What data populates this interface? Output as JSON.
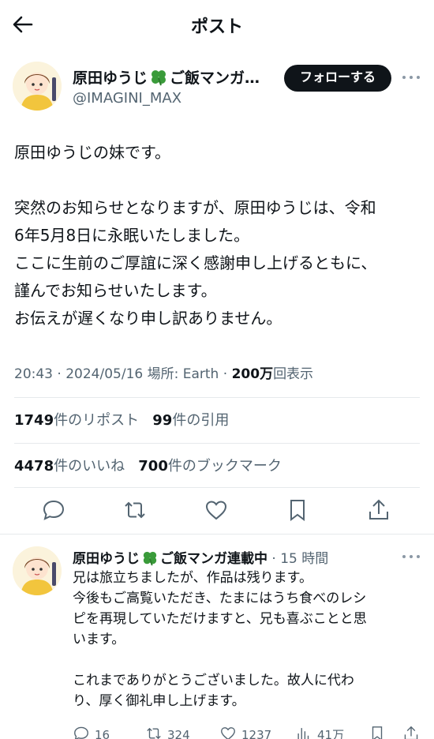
{
  "header": {
    "title": "ポスト"
  },
  "post": {
    "author": {
      "name_before": "原田ゆうじ",
      "name_after": "ご飯マンガ…",
      "handle": "@IMAGINI_MAX"
    },
    "follow_label": "フォローする",
    "body": [
      "原田ゆうじの妹です。",
      "",
      "突然のお知らせとなりますが、原田ゆうじは、令和",
      "6年5月8日に永眠いたしました。",
      "ここに生前のご厚誼に深く感謝申し上げるともに、",
      "謹んでお知らせいたします。",
      "お伝えが遅くなり申し訳ありません。"
    ],
    "meta": {
      "time": "20:43",
      "date": "2024/05/16",
      "location_label": "場所: Earth",
      "views_number": "200",
      "views_unit": "万",
      "views_label": "回表示"
    },
    "stats": {
      "reposts": "1749",
      "reposts_label": "件のリポスト",
      "quotes": "99",
      "quotes_label": "件の引用",
      "likes": "4478",
      "likes_label": "件のいいね",
      "bookmarks": "700",
      "bookmarks_label": "件のブックマーク"
    },
    "actions": [
      "reply-icon",
      "repost-icon",
      "like-icon",
      "bookmark-icon",
      "share-icon"
    ]
  },
  "reply": {
    "author": {
      "name_before": "原田ゆうじ",
      "name_after": "ご飯マンガ連載中",
      "time": "15 時間"
    },
    "body": [
      "兄は旅立ちましたが、作品は残ります。",
      "今後もご高覧いただき、たまにはうち食べのレシ",
      "ピを再現していただけますと、兄も喜ぶことと思",
      "います。",
      "",
      "これまでありがとうございました。故人に代わ",
      "り、厚く御礼申し上げます。"
    ],
    "counts": {
      "replies": "16",
      "reposts": "324",
      "likes": "1237",
      "views": "41万"
    }
  },
  "colors": {
    "text": "#0f1419",
    "muted": "#536471",
    "divider": "#e6e9ec",
    "clover": "#3a9b3a"
  }
}
